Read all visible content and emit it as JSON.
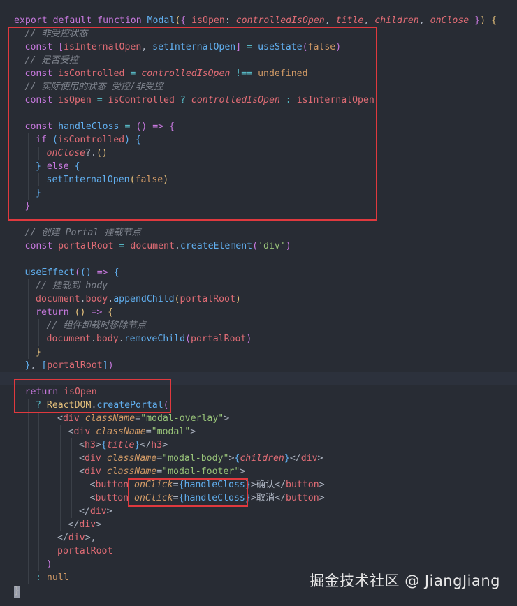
{
  "editor": {
    "lines": [
      {
        "indent": 0,
        "guides": 0,
        "tokens": [
          [
            "kw",
            "export"
          ],
          [
            "plain",
            " "
          ],
          [
            "kw",
            "default"
          ],
          [
            "plain",
            " "
          ],
          [
            "kw",
            "function"
          ],
          [
            "plain",
            " "
          ],
          [
            "fn",
            "Modal"
          ],
          [
            "br1",
            "("
          ],
          [
            "br2",
            "{"
          ],
          [
            "plain",
            " "
          ],
          [
            "var",
            "isOpen"
          ],
          [
            "punc",
            ": "
          ],
          [
            "param",
            "controlledIsOpen"
          ],
          [
            "punc",
            ", "
          ],
          [
            "param",
            "title"
          ],
          [
            "punc",
            ", "
          ],
          [
            "param",
            "children"
          ],
          [
            "punc",
            ", "
          ],
          [
            "param",
            "onClose"
          ],
          [
            "plain",
            " "
          ],
          [
            "br2",
            "}"
          ],
          [
            "br1",
            ")"
          ],
          [
            "plain",
            " "
          ],
          [
            "br1",
            "{"
          ]
        ]
      },
      {
        "indent": 1,
        "guides": 0,
        "tokens": [
          [
            "cmt",
            "// 非受控状态"
          ]
        ]
      },
      {
        "indent": 1,
        "guides": 0,
        "tokens": [
          [
            "kw",
            "const"
          ],
          [
            "plain",
            " "
          ],
          [
            "br2",
            "["
          ],
          [
            "var",
            "isInternalOpen"
          ],
          [
            "punc",
            ", "
          ],
          [
            "fn",
            "setInternalOpen"
          ],
          [
            "br2",
            "]"
          ],
          [
            "plain",
            " "
          ],
          [
            "op",
            "="
          ],
          [
            "plain",
            " "
          ],
          [
            "fn",
            "useState"
          ],
          [
            "br2",
            "("
          ],
          [
            "bool",
            "false"
          ],
          [
            "br2",
            ")"
          ]
        ]
      },
      {
        "indent": 1,
        "guides": 0,
        "tokens": [
          [
            "cmt",
            "// 是否受控"
          ]
        ]
      },
      {
        "indent": 1,
        "guides": 0,
        "tokens": [
          [
            "kw",
            "const"
          ],
          [
            "plain",
            " "
          ],
          [
            "var",
            "isControlled"
          ],
          [
            "plain",
            " "
          ],
          [
            "op",
            "="
          ],
          [
            "plain",
            " "
          ],
          [
            "param",
            "controlledIsOpen"
          ],
          [
            "plain",
            " "
          ],
          [
            "op",
            "!=="
          ],
          [
            "plain",
            " "
          ],
          [
            "bool",
            "undefined"
          ]
        ]
      },
      {
        "indent": 1,
        "guides": 0,
        "tokens": [
          [
            "cmt",
            "// 实际使用的状态 受控/非受控"
          ]
        ]
      },
      {
        "indent": 1,
        "guides": 0,
        "tokens": [
          [
            "kw",
            "const"
          ],
          [
            "plain",
            " "
          ],
          [
            "var",
            "isOpen"
          ],
          [
            "plain",
            " "
          ],
          [
            "op",
            "="
          ],
          [
            "plain",
            " "
          ],
          [
            "var",
            "isControlled"
          ],
          [
            "plain",
            " "
          ],
          [
            "op",
            "?"
          ],
          [
            "plain",
            " "
          ],
          [
            "param",
            "controlledIsOpen"
          ],
          [
            "plain",
            " "
          ],
          [
            "op",
            ":"
          ],
          [
            "plain",
            " "
          ],
          [
            "var",
            "isInternalOpen"
          ]
        ]
      },
      {
        "indent": 0,
        "guides": 0,
        "tokens": []
      },
      {
        "indent": 1,
        "guides": 0,
        "tokens": [
          [
            "kw",
            "const"
          ],
          [
            "plain",
            " "
          ],
          [
            "fn",
            "handleCloss"
          ],
          [
            "plain",
            " "
          ],
          [
            "op",
            "="
          ],
          [
            "plain",
            " "
          ],
          [
            "br2",
            "("
          ],
          [
            "br2",
            ")"
          ],
          [
            "plain",
            " "
          ],
          [
            "kw",
            "=>"
          ],
          [
            "plain",
            " "
          ],
          [
            "br2",
            "{"
          ]
        ]
      },
      {
        "indent": 2,
        "guides": 1,
        "tokens": [
          [
            "kw",
            "if"
          ],
          [
            "plain",
            " "
          ],
          [
            "br3",
            "("
          ],
          [
            "var",
            "isControlled"
          ],
          [
            "br3",
            ")"
          ],
          [
            "plain",
            " "
          ],
          [
            "br3",
            "{"
          ]
        ]
      },
      {
        "indent": 3,
        "guides": 2,
        "tokens": [
          [
            "param",
            "onClose"
          ],
          [
            "punc",
            "?."
          ],
          [
            "br1",
            "("
          ],
          [
            "br1",
            ")"
          ]
        ]
      },
      {
        "indent": 2,
        "guides": 1,
        "tokens": [
          [
            "br3",
            "}"
          ],
          [
            "plain",
            " "
          ],
          [
            "kw",
            "else"
          ],
          [
            "plain",
            " "
          ],
          [
            "br3",
            "{"
          ]
        ]
      },
      {
        "indent": 3,
        "guides": 2,
        "tokens": [
          [
            "fn",
            "setInternalOpen"
          ],
          [
            "br1",
            "("
          ],
          [
            "bool",
            "false"
          ],
          [
            "br1",
            ")"
          ]
        ]
      },
      {
        "indent": 2,
        "guides": 1,
        "tokens": [
          [
            "br3",
            "}"
          ]
        ]
      },
      {
        "indent": 1,
        "guides": 0,
        "tokens": [
          [
            "br2",
            "}"
          ]
        ]
      },
      {
        "indent": 0,
        "guides": 0,
        "tokens": []
      },
      {
        "indent": 1,
        "guides": 0,
        "tokens": [
          [
            "cmt",
            "// 创建 Portal 挂载节点"
          ]
        ]
      },
      {
        "indent": 1,
        "guides": 0,
        "tokens": [
          [
            "kw",
            "const"
          ],
          [
            "plain",
            " "
          ],
          [
            "var",
            "portalRoot"
          ],
          [
            "plain",
            " "
          ],
          [
            "op",
            "="
          ],
          [
            "plain",
            " "
          ],
          [
            "var",
            "document"
          ],
          [
            "punc",
            "."
          ],
          [
            "fn",
            "createElement"
          ],
          [
            "br2",
            "("
          ],
          [
            "str",
            "'div'"
          ],
          [
            "br2",
            ")"
          ]
        ]
      },
      {
        "indent": 0,
        "guides": 0,
        "tokens": []
      },
      {
        "indent": 1,
        "guides": 0,
        "tokens": [
          [
            "fn",
            "useEffect"
          ],
          [
            "br2",
            "("
          ],
          [
            "br3",
            "("
          ],
          [
            "br3",
            ")"
          ],
          [
            "plain",
            " "
          ],
          [
            "kw",
            "=>"
          ],
          [
            "plain",
            " "
          ],
          [
            "br3",
            "{"
          ]
        ]
      },
      {
        "indent": 2,
        "guides": 1,
        "tokens": [
          [
            "cmt",
            "// 挂载到 body"
          ]
        ]
      },
      {
        "indent": 2,
        "guides": 1,
        "tokens": [
          [
            "var",
            "document"
          ],
          [
            "punc",
            "."
          ],
          [
            "var",
            "body"
          ],
          [
            "punc",
            "."
          ],
          [
            "fn",
            "appendChild"
          ],
          [
            "br1",
            "("
          ],
          [
            "var",
            "portalRoot"
          ],
          [
            "br1",
            ")"
          ]
        ]
      },
      {
        "indent": 2,
        "guides": 1,
        "tokens": [
          [
            "kw",
            "return"
          ],
          [
            "plain",
            " "
          ],
          [
            "br1",
            "("
          ],
          [
            "br1",
            ")"
          ],
          [
            "plain",
            " "
          ],
          [
            "kw",
            "=>"
          ],
          [
            "plain",
            " "
          ],
          [
            "br1",
            "{"
          ]
        ]
      },
      {
        "indent": 3,
        "guides": 2,
        "tokens": [
          [
            "cmt",
            "// 组件卸载时移除节点"
          ]
        ]
      },
      {
        "indent": 3,
        "guides": 2,
        "tokens": [
          [
            "var",
            "document"
          ],
          [
            "punc",
            "."
          ],
          [
            "var",
            "body"
          ],
          [
            "punc",
            "."
          ],
          [
            "fn",
            "removeChild"
          ],
          [
            "br2",
            "("
          ],
          [
            "var",
            "portalRoot"
          ],
          [
            "br2",
            ")"
          ]
        ]
      },
      {
        "indent": 2,
        "guides": 1,
        "tokens": [
          [
            "br1",
            "}"
          ]
        ]
      },
      {
        "indent": 1,
        "guides": 0,
        "tokens": [
          [
            "br3",
            "}"
          ],
          [
            "punc",
            ", "
          ],
          [
            "br3",
            "["
          ],
          [
            "var",
            "portalRoot"
          ],
          [
            "br3",
            "]"
          ],
          [
            "br2",
            ")"
          ]
        ]
      },
      {
        "indent": 0,
        "guides": 0,
        "tokens": [],
        "active": true
      },
      {
        "indent": 1,
        "guides": 0,
        "tokens": [
          [
            "kw",
            "return"
          ],
          [
            "plain",
            " "
          ],
          [
            "var",
            "isOpen"
          ]
        ]
      },
      {
        "indent": 2,
        "guides": 1,
        "tokens": [
          [
            "op",
            "?"
          ],
          [
            "plain",
            " "
          ],
          [
            "prop",
            "ReactDOM"
          ],
          [
            "punc",
            "."
          ],
          [
            "fn",
            "createPortal"
          ],
          [
            "br2",
            "("
          ]
        ]
      },
      {
        "indent": 4,
        "guides": 3,
        "tokens": [
          [
            "punc",
            "<"
          ],
          [
            "tag",
            "div"
          ],
          [
            "plain",
            " "
          ],
          [
            "attr",
            "className"
          ],
          [
            "punc",
            "="
          ],
          [
            "str",
            "\"modal-overlay\""
          ],
          [
            "punc",
            ">"
          ]
        ]
      },
      {
        "indent": 5,
        "guides": 4,
        "tokens": [
          [
            "punc",
            "<"
          ],
          [
            "tag",
            "div"
          ],
          [
            "plain",
            " "
          ],
          [
            "attr",
            "className"
          ],
          [
            "punc",
            "="
          ],
          [
            "str",
            "\"modal\""
          ],
          [
            "punc",
            ">"
          ]
        ]
      },
      {
        "indent": 6,
        "guides": 5,
        "tokens": [
          [
            "punc",
            "<"
          ],
          [
            "tag",
            "h3"
          ],
          [
            "punc",
            ">"
          ],
          [
            "br3",
            "{"
          ],
          [
            "param",
            "title"
          ],
          [
            "br3",
            "}"
          ],
          [
            "punc",
            "</"
          ],
          [
            "tag",
            "h3"
          ],
          [
            "punc",
            ">"
          ]
        ]
      },
      {
        "indent": 6,
        "guides": 5,
        "tokens": [
          [
            "punc",
            "<"
          ],
          [
            "tag",
            "div"
          ],
          [
            "plain",
            " "
          ],
          [
            "attr",
            "className"
          ],
          [
            "punc",
            "="
          ],
          [
            "str",
            "\"modal-body\""
          ],
          [
            "punc",
            ">"
          ],
          [
            "br3",
            "{"
          ],
          [
            "param",
            "children"
          ],
          [
            "br3",
            "}"
          ],
          [
            "punc",
            "</"
          ],
          [
            "tag",
            "div"
          ],
          [
            "punc",
            ">"
          ]
        ]
      },
      {
        "indent": 6,
        "guides": 5,
        "tokens": [
          [
            "punc",
            "<"
          ],
          [
            "tag",
            "div"
          ],
          [
            "plain",
            " "
          ],
          [
            "attr",
            "className"
          ],
          [
            "punc",
            "="
          ],
          [
            "str",
            "\"modal-footer\""
          ],
          [
            "punc",
            ">"
          ]
        ]
      },
      {
        "indent": 7,
        "guides": 6,
        "tokens": [
          [
            "punc",
            "<"
          ],
          [
            "tag",
            "button"
          ],
          [
            "plain",
            " "
          ],
          [
            "attr",
            "onClick"
          ],
          [
            "punc",
            "="
          ],
          [
            "br3",
            "{"
          ],
          [
            "fn",
            "handleCloss"
          ],
          [
            "br3",
            "}"
          ],
          [
            "punc",
            ">"
          ],
          [
            "plain",
            "确认"
          ],
          [
            "punc",
            "</"
          ],
          [
            "tag",
            "button"
          ],
          [
            "punc",
            ">"
          ]
        ]
      },
      {
        "indent": 7,
        "guides": 6,
        "tokens": [
          [
            "punc",
            "<"
          ],
          [
            "tag",
            "button"
          ],
          [
            "plain",
            " "
          ],
          [
            "attr",
            "onClick"
          ],
          [
            "punc",
            "="
          ],
          [
            "br3",
            "{"
          ],
          [
            "fn",
            "handleCloss"
          ],
          [
            "br3",
            "}"
          ],
          [
            "punc",
            ">"
          ],
          [
            "plain",
            "取消"
          ],
          [
            "punc",
            "</"
          ],
          [
            "tag",
            "button"
          ],
          [
            "punc",
            ">"
          ]
        ]
      },
      {
        "indent": 6,
        "guides": 5,
        "tokens": [
          [
            "punc",
            "</"
          ],
          [
            "tag",
            "div"
          ],
          [
            "punc",
            ">"
          ]
        ]
      },
      {
        "indent": 5,
        "guides": 4,
        "tokens": [
          [
            "punc",
            "</"
          ],
          [
            "tag",
            "div"
          ],
          [
            "punc",
            ">"
          ]
        ]
      },
      {
        "indent": 4,
        "guides": 3,
        "tokens": [
          [
            "punc",
            "</"
          ],
          [
            "tag",
            "div"
          ],
          [
            "punc",
            ">,"
          ]
        ]
      },
      {
        "indent": 4,
        "guides": 3,
        "tokens": [
          [
            "var",
            "portalRoot"
          ]
        ]
      },
      {
        "indent": 3,
        "guides": 2,
        "tokens": [
          [
            "br2",
            ")"
          ]
        ]
      },
      {
        "indent": 2,
        "guides": 1,
        "tokens": [
          [
            "op",
            ":"
          ],
          [
            "plain",
            " "
          ],
          [
            "bool",
            "null"
          ]
        ]
      },
      {
        "indent": 0,
        "guides": 0,
        "tokens": [
          [
            "br1",
            "}"
          ]
        ]
      }
    ]
  },
  "highlight_color": "#e0393e",
  "watermark": {
    "text": "掘金技术社区 @ JiangJiang"
  }
}
